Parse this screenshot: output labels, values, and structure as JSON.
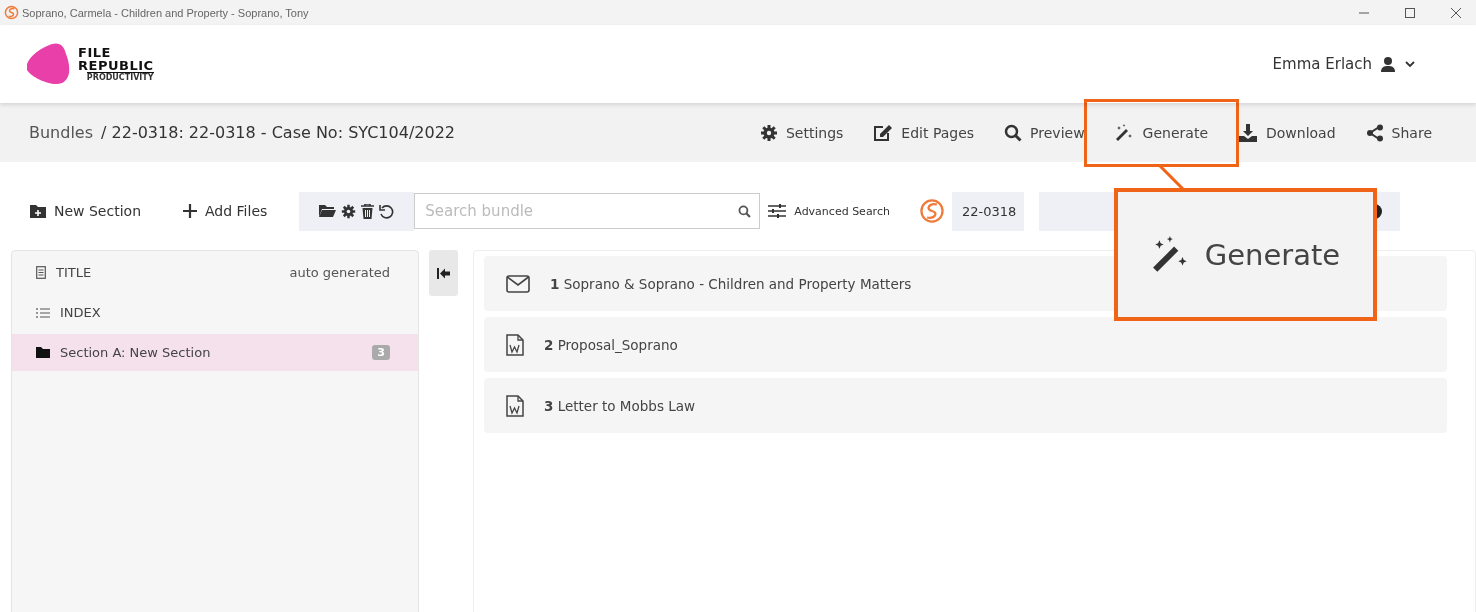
{
  "window": {
    "title": "Soprano, Carmela - Children and Property - Soprano, Tony"
  },
  "logo": {
    "line1": "FILE",
    "line2": "REPUBLIC",
    "tagline": "PRODUCTIVITY"
  },
  "user": {
    "name": "Emma Erlach"
  },
  "breadcrumb": {
    "root": "Bundles",
    "current": "/ 22-0318: 22-0318 - Case No: SYC104/2022"
  },
  "actions": [
    {
      "kind": "settings",
      "label": "Settings",
      "highlighted": false
    },
    {
      "kind": "edit",
      "label": "Edit Pages",
      "highlighted": false
    },
    {
      "kind": "preview",
      "label": "Preview",
      "highlighted": false
    },
    {
      "kind": "generate",
      "label": "Generate",
      "highlighted": true
    },
    {
      "kind": "download",
      "label": "Download",
      "highlighted": false
    },
    {
      "kind": "share",
      "label": "Share",
      "highlighted": false
    }
  ],
  "toolbar": {
    "new_section": "New Section",
    "add_files": "Add Files",
    "search": {
      "placeholder": "Search bundle"
    },
    "advanced_search": "Advanced Search",
    "bundle_ref": "22-0318"
  },
  "sidebar": {
    "items": [
      {
        "kind": "title",
        "label": "TITLE",
        "note": "auto generated",
        "selected": false
      },
      {
        "kind": "index",
        "label": "INDEX",
        "selected": false
      },
      {
        "kind": "section",
        "label": "Section A: New Section",
        "count": "3",
        "selected": true
      }
    ]
  },
  "files": [
    {
      "kind": "email",
      "title": "**1** Soprano & Soprano - Children and Property Matters"
    },
    {
      "kind": "word",
      "title": "**2** Proposal_Soprano"
    },
    {
      "kind": "word",
      "title": "**3** Letter to Mobbs Law"
    }
  ],
  "callout": {
    "label": "Generate"
  }
}
